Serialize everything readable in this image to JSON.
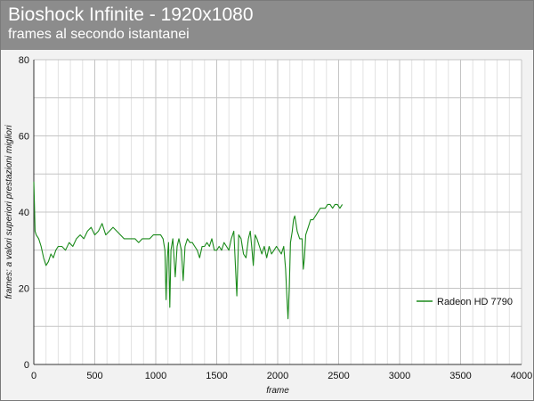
{
  "chart_data": {
    "type": "line",
    "title": "Bioshock Infinite - 1920x1080",
    "subtitle": "frames al secondo istantanei",
    "xlabel": "frame",
    "ylabel": "frames: a valori superiori prestazioni migliori",
    "xlim": [
      0,
      4000
    ],
    "ylim": [
      0,
      80
    ],
    "xticks": [
      0,
      500,
      1000,
      1500,
      2000,
      2500,
      3000,
      3500,
      4000
    ],
    "yticks": [
      0,
      20,
      40,
      60,
      80
    ],
    "grid": true,
    "legend_position": "right",
    "series": [
      {
        "name": "Radeon HD 7790",
        "color": "#1a8a1a",
        "points": [
          [
            0,
            48
          ],
          [
            5,
            42
          ],
          [
            10,
            35
          ],
          [
            20,
            34
          ],
          [
            40,
            33
          ],
          [
            60,
            31
          ],
          [
            80,
            28
          ],
          [
            100,
            26
          ],
          [
            120,
            27
          ],
          [
            140,
            29
          ],
          [
            160,
            28
          ],
          [
            180,
            30
          ],
          [
            200,
            31
          ],
          [
            230,
            31
          ],
          [
            260,
            30
          ],
          [
            290,
            32
          ],
          [
            320,
            31
          ],
          [
            350,
            33
          ],
          [
            380,
            34
          ],
          [
            410,
            33
          ],
          [
            440,
            35
          ],
          [
            470,
            36
          ],
          [
            500,
            34
          ],
          [
            530,
            35
          ],
          [
            560,
            37
          ],
          [
            590,
            34
          ],
          [
            620,
            35
          ],
          [
            650,
            36
          ],
          [
            680,
            35
          ],
          [
            710,
            34
          ],
          [
            740,
            33
          ],
          [
            770,
            33
          ],
          [
            800,
            33
          ],
          [
            830,
            33
          ],
          [
            860,
            32
          ],
          [
            890,
            33
          ],
          [
            920,
            33
          ],
          [
            950,
            33
          ],
          [
            980,
            34
          ],
          [
            1010,
            34
          ],
          [
            1040,
            34
          ],
          [
            1060,
            33
          ],
          [
            1075,
            30
          ],
          [
            1085,
            17
          ],
          [
            1095,
            28
          ],
          [
            1105,
            32
          ],
          [
            1115,
            15
          ],
          [
            1125,
            30
          ],
          [
            1140,
            33
          ],
          [
            1160,
            23
          ],
          [
            1175,
            31
          ],
          [
            1190,
            33
          ],
          [
            1210,
            30
          ],
          [
            1225,
            22
          ],
          [
            1240,
            31
          ],
          [
            1260,
            33
          ],
          [
            1280,
            32
          ],
          [
            1300,
            32
          ],
          [
            1320,
            31
          ],
          [
            1340,
            30
          ],
          [
            1360,
            28
          ],
          [
            1380,
            31
          ],
          [
            1400,
            31
          ],
          [
            1420,
            32
          ],
          [
            1440,
            31
          ],
          [
            1460,
            33
          ],
          [
            1480,
            30
          ],
          [
            1500,
            30
          ],
          [
            1520,
            31
          ],
          [
            1540,
            30
          ],
          [
            1560,
            32
          ],
          [
            1580,
            31
          ],
          [
            1600,
            30
          ],
          [
            1620,
            33
          ],
          [
            1640,
            35
          ],
          [
            1655,
            25
          ],
          [
            1665,
            18
          ],
          [
            1680,
            34
          ],
          [
            1700,
            33
          ],
          [
            1720,
            29
          ],
          [
            1740,
            28
          ],
          [
            1760,
            33
          ],
          [
            1775,
            35
          ],
          [
            1790,
            30
          ],
          [
            1800,
            26
          ],
          [
            1815,
            34
          ],
          [
            1830,
            33
          ],
          [
            1850,
            31
          ],
          [
            1870,
            29
          ],
          [
            1890,
            31
          ],
          [
            1910,
            28
          ],
          [
            1930,
            31
          ],
          [
            1950,
            29
          ],
          [
            1970,
            30
          ],
          [
            1990,
            31
          ],
          [
            2010,
            30
          ],
          [
            2030,
            29
          ],
          [
            2050,
            31
          ],
          [
            2065,
            25
          ],
          [
            2075,
            18
          ],
          [
            2085,
            12
          ],
          [
            2095,
            20
          ],
          [
            2105,
            32
          ],
          [
            2120,
            35
          ],
          [
            2130,
            38
          ],
          [
            2140,
            39
          ],
          [
            2150,
            37
          ],
          [
            2160,
            35
          ],
          [
            2180,
            33
          ],
          [
            2200,
            33
          ],
          [
            2210,
            25
          ],
          [
            2220,
            28
          ],
          [
            2230,
            34
          ],
          [
            2250,
            36
          ],
          [
            2270,
            38
          ],
          [
            2290,
            38
          ],
          [
            2310,
            39
          ],
          [
            2330,
            40
          ],
          [
            2350,
            41
          ],
          [
            2370,
            41
          ],
          [
            2390,
            41
          ],
          [
            2410,
            42
          ],
          [
            2430,
            42
          ],
          [
            2450,
            41
          ],
          [
            2470,
            42
          ],
          [
            2490,
            42
          ],
          [
            2510,
            41
          ],
          [
            2530,
            42
          ]
        ]
      }
    ]
  }
}
